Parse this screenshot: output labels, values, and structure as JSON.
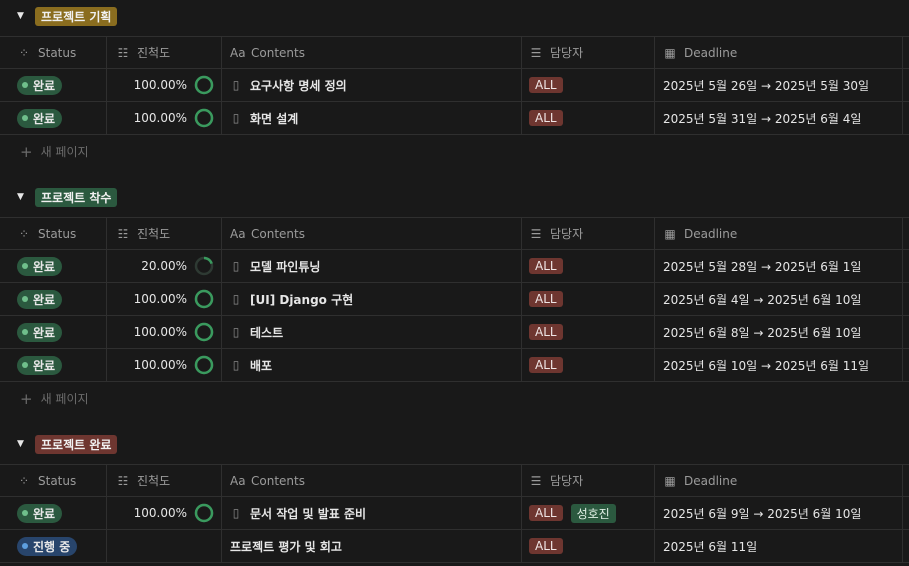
{
  "headers": {
    "status": "Status",
    "progress": "진척도",
    "contents": "Contents",
    "owner": "담당자",
    "deadline": "Deadline",
    "contents_icon": "Aa"
  },
  "new_page_label": "새 페이지",
  "groups": [
    {
      "name": "프로젝트 기획",
      "color": "#8a6d1f",
      "rows": [
        {
          "status": "완료",
          "progress": "100.00%",
          "progress_fraction": 1.0,
          "content": "요구사항 명세 정의",
          "owners": [
            "ALL"
          ],
          "deadline": "2025년 5월 26일 → 2025년 5월 30일"
        },
        {
          "status": "완료",
          "progress": "100.00%",
          "progress_fraction": 1.0,
          "content": "화면 설계",
          "owners": [
            "ALL"
          ],
          "deadline": "2025년 5월 31일 → 2025년 6월 4일"
        }
      ]
    },
    {
      "name": "프로젝트 착수",
      "color": "#2b593f",
      "rows": [
        {
          "status": "완료",
          "progress": "20.00%",
          "progress_fraction": 0.2,
          "content": "모델 파인튜닝",
          "owners": [
            "ALL"
          ],
          "deadline": "2025년 5월 28일 → 2025년 6월 1일"
        },
        {
          "status": "완료",
          "progress": "100.00%",
          "progress_fraction": 1.0,
          "content": "[UI] Django 구현",
          "owners": [
            "ALL"
          ],
          "deadline": "2025년 6월 4일 → 2025년 6월 10일"
        },
        {
          "status": "완료",
          "progress": "100.00%",
          "progress_fraction": 1.0,
          "content": "테스트",
          "owners": [
            "ALL"
          ],
          "deadline": "2025년 6월 8일 → 2025년 6월 10일"
        },
        {
          "status": "완료",
          "progress": "100.00%",
          "progress_fraction": 1.0,
          "content": "배포",
          "owners": [
            "ALL"
          ],
          "deadline": "2025년 6월 10일 → 2025년 6월 11일"
        }
      ]
    },
    {
      "name": "프로젝트 완료",
      "color": "#6e3630",
      "rows": [
        {
          "status": "완료",
          "progress": "100.00%",
          "progress_fraction": 1.0,
          "content": "문서 작업 및 발표 준비",
          "owners": [
            "ALL",
            "성호진"
          ],
          "deadline": "2025년 6월 9일 → 2025년 6월 10일"
        },
        {
          "status": "진행 중",
          "progress": "",
          "progress_fraction": null,
          "content": "프로젝트 평가 및 회고",
          "owners": [
            "ALL"
          ],
          "deadline": "2025년 6월 11일"
        }
      ]
    }
  ],
  "colors": {
    "status_done": "#2b593f",
    "status_in_progress": "#28456c",
    "owner_all": "#6e3630",
    "owner_person": "#2b593f",
    "ring": "#3a9a5e"
  }
}
